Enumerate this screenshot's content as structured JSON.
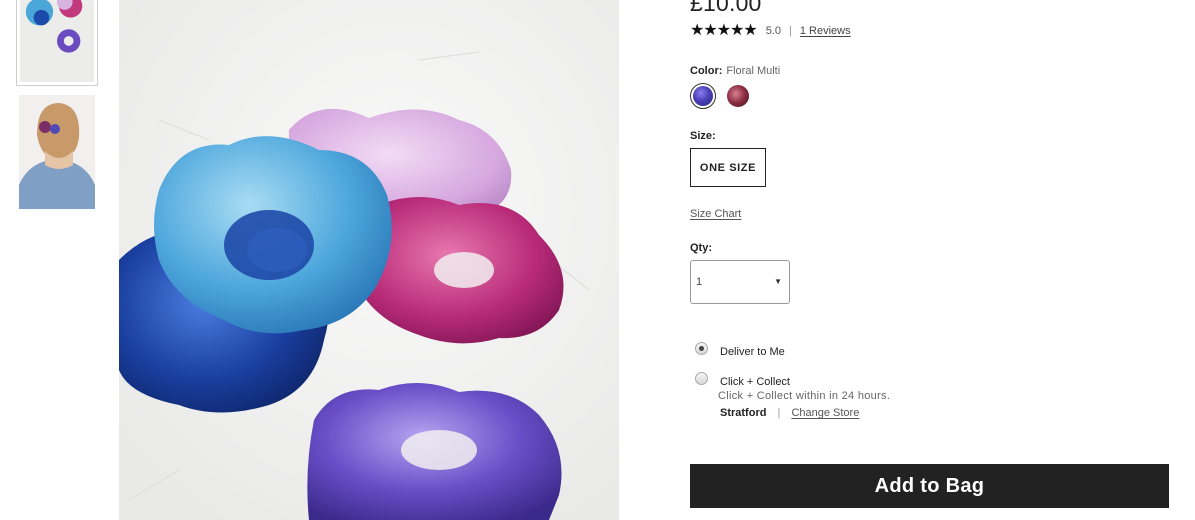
{
  "product": {
    "price": "£10.00",
    "stars": "★★★★★",
    "rating_value": "5.0",
    "rating_separator": "|",
    "reviews_link": "1 Reviews"
  },
  "color": {
    "label": "Color:",
    "selected_value": "Floral Multi"
  },
  "size": {
    "label": "Size:",
    "option": "ONE SIZE",
    "chart_link": "Size Chart"
  },
  "qty": {
    "label": "Qty:",
    "value": "1",
    "arrow": "▼"
  },
  "delivery": {
    "option1_label": "Deliver to Me",
    "option2_label": "Click + Collect",
    "option2_note": "Click + Collect within in 24 hours.",
    "store_name": "Stratford",
    "store_separator": "|",
    "change_store": "Change Store"
  },
  "cta": {
    "add_to_bag": "Add to Bag"
  },
  "colors": {
    "button_bg": "#222222",
    "selected_swatch": "#4a3fb5",
    "alt_swatch": "#8a2a40"
  }
}
